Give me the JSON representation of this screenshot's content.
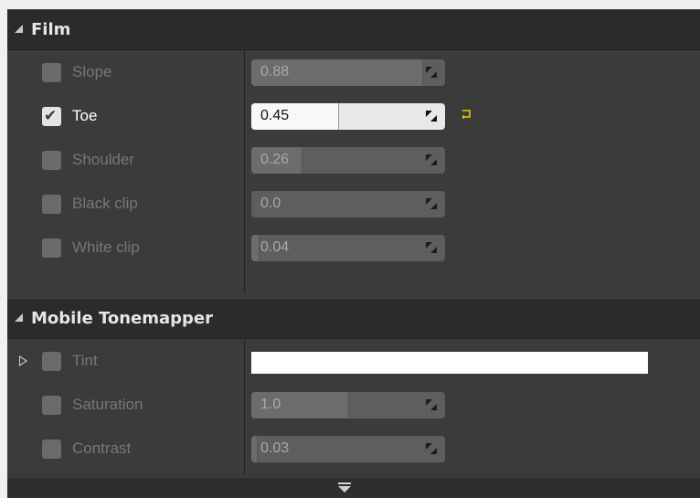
{
  "sections": [
    {
      "title": "Film",
      "rows": [
        {
          "label": "Slope",
          "value": "0.88",
          "checked": false,
          "fill": 0.88
        },
        {
          "label": "Toe",
          "value": "0.45",
          "checked": true,
          "fill": 0.45,
          "reset_visible": true
        },
        {
          "label": "Shoulder",
          "value": "0.26",
          "checked": false,
          "fill": 0.26
        },
        {
          "label": "Black clip",
          "value": "0.0",
          "checked": false,
          "fill": 0.0
        },
        {
          "label": "White clip",
          "value": "0.04",
          "checked": false,
          "fill": 0.04
        }
      ]
    },
    {
      "title": "Mobile Tonemapper",
      "rows": [
        {
          "label": "Tint",
          "type": "color",
          "color": "#ffffff",
          "checked": false
        },
        {
          "label": "Saturation",
          "value": "1.0",
          "checked": false,
          "fill": 0.5
        },
        {
          "label": "Contrast",
          "value": "0.03",
          "checked": false,
          "fill": 0.03
        }
      ]
    }
  ],
  "icons": {
    "collapse": "triangle-down-icon",
    "expand": "triangle-right-icon",
    "drag": "drag-arrows-icon",
    "reset": "reset-arrow-icon",
    "more": "chevron-down-icon"
  },
  "colors": {
    "accent_reset": "#e8d000",
    "checkbox_on": "#e4e4e4",
    "checkbox_off": "#6a6a6a"
  }
}
